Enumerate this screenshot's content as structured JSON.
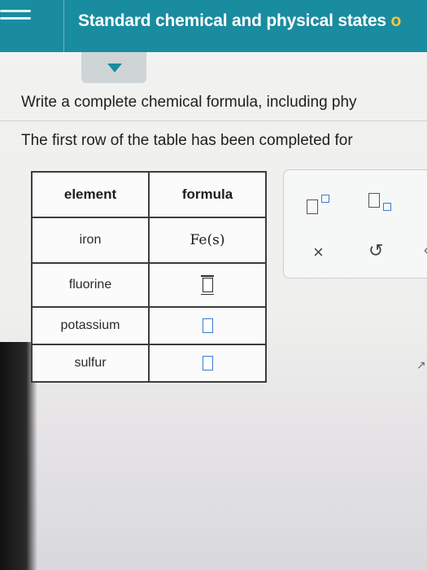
{
  "header": {
    "title": "Standard chemical and physical states",
    "title_overflow": " o"
  },
  "instructions": {
    "line1": "Write a complete chemical formula, including phy",
    "line2": "The first row of the table has been completed for"
  },
  "table": {
    "headers": [
      "element",
      "formula"
    ],
    "rows": [
      {
        "element": "iron",
        "formula": "Fe(s)"
      },
      {
        "element": "fluorine",
        "formula": ""
      },
      {
        "element": "potassium",
        "formula": ""
      },
      {
        "element": "sulfur",
        "formula": ""
      }
    ]
  },
  "toolbar": {
    "clear_symbol": "×",
    "undo_symbol": "↺",
    "more_symbol": "‹"
  },
  "icons": {
    "menu": "hamburger-icon",
    "collapse": "caret-down-icon",
    "superscript": "superscript-icon",
    "subscript": "subscript-icon",
    "clear": "close-icon",
    "undo": "undo-icon"
  },
  "colors": {
    "header_bg": "#1a8ca0",
    "accent": "#3a7bd5"
  }
}
